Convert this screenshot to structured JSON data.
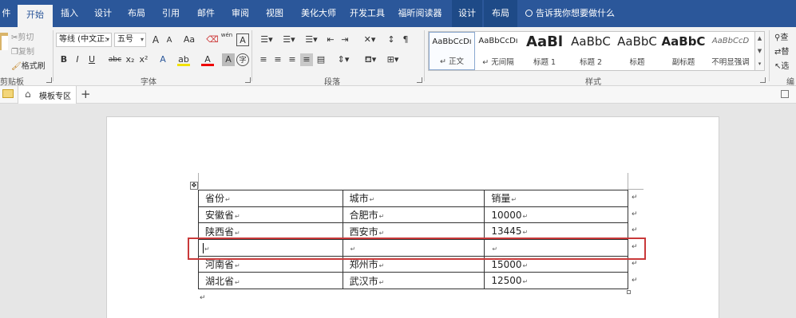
{
  "tabs": [
    {
      "label": "件"
    },
    {
      "label": "开始",
      "active": true
    },
    {
      "label": "插入"
    },
    {
      "label": "设计"
    },
    {
      "label": "布局"
    },
    {
      "label": "引用"
    },
    {
      "label": "邮件"
    },
    {
      "label": "审阅"
    },
    {
      "label": "视图"
    },
    {
      "label": "美化大师"
    },
    {
      "label": "开发工具"
    },
    {
      "label": "福昕阅读器"
    },
    {
      "label": "设计",
      "contextual": true
    },
    {
      "label": "布局",
      "contextual": true
    }
  ],
  "tell_me": "告诉我你想要做什么",
  "clipboard": {
    "cut": "剪切",
    "copy": "复制",
    "format_painter": "格式刷",
    "group": "剪贴板"
  },
  "font": {
    "name": "等线 (中文正\t",
    "name_display": "等线 (中文正:",
    "size": "五号",
    "group": "字体",
    "grow": "A",
    "shrink": "A",
    "case": "Aa",
    "phonetic": "wén",
    "bold": "B",
    "italic": "I",
    "underline": "U",
    "strike": "abc",
    "subscript": "x₂",
    "superscript": "x²"
  },
  "paragraph": {
    "group": "段落"
  },
  "styles": {
    "group": "样式",
    "items": [
      {
        "sample": "AaBbCcDı",
        "name": "↵ 正文"
      },
      {
        "sample": "AaBbCcDı",
        "name": "↵ 无间隔"
      },
      {
        "sample": "AaBl",
        "name": "标题 1"
      },
      {
        "sample": "AaBbC",
        "name": "标题 2"
      },
      {
        "sample": "AaBbC",
        "name": "标题"
      },
      {
        "sample": "AaBbC",
        "name": "副标题"
      },
      {
        "sample": "AaBbCcD",
        "name": "不明显强调"
      }
    ]
  },
  "editing": {
    "find": "查",
    "replace": "替",
    "select": "选",
    "group": "编"
  },
  "docstrip": {
    "template_tab": "模板专区",
    "add": "+"
  },
  "table": {
    "rows": [
      [
        "省份",
        "城市",
        "销量"
      ],
      [
        "安徽省",
        "合肥市",
        "10000"
      ],
      [
        "陕西省",
        "西安市",
        "13445"
      ],
      [
        "",
        "",
        ""
      ],
      [
        "河南省",
        "郑州市",
        "15000"
      ],
      [
        "湖北省",
        "武汉市",
        "12500"
      ]
    ]
  },
  "colors": {
    "tab_blue": "#2b579a",
    "highlight_red": "#c9393a"
  },
  "marks": {
    "cell_end": "↵",
    "move_handle": "✥"
  }
}
